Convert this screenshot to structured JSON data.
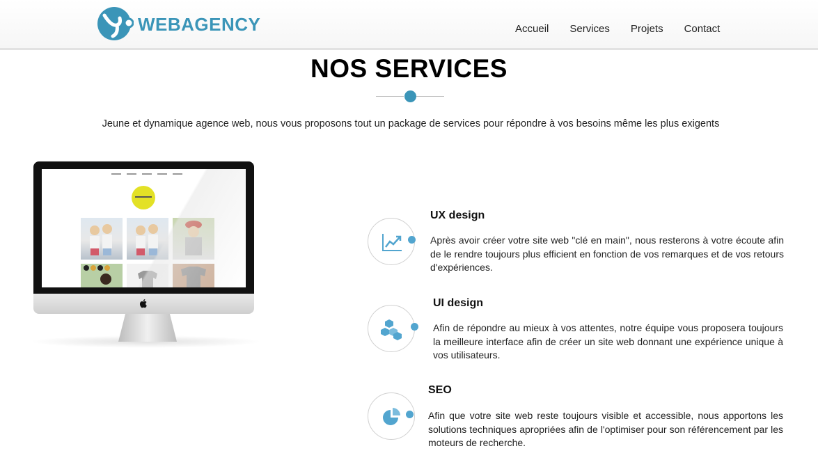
{
  "header": {
    "logo_text": "WEBAGENCY",
    "nav": [
      "Accueil",
      "Services",
      "Projets",
      "Contact"
    ]
  },
  "section": {
    "title": "NOS SERVICES",
    "intro": "Jeune et dynamique agence web, nous vous proposons tout un package de services pour répondre à vos besoins même les plus exigents"
  },
  "services": [
    {
      "title": "UX design",
      "text": "Après avoir créer votre site web \"clé en main\", nous resterons à votre écoute afin de le rendre toujours plus efficient en fonction de vos remarques et de vos retours d'expériences.",
      "icon": "chart-line-icon"
    },
    {
      "title": "UI design",
      "text": "Afin de répondre au mieux à vos attentes, notre équipe vous proposera toujours la meilleure interface afin de créer un site web donnant une expérience unique à vos utilisateurs.",
      "icon": "cubes-icon"
    },
    {
      "title": "SEO",
      "text": "Afin que votre site web reste toujours visible et accessible, nous apportons les solutions techniques apropriées afin de l'optimiser pour son référencement par les moteurs de recherche.",
      "icon": "pie-chart-icon"
    }
  ],
  "colors": {
    "accent": "#3b95b8",
    "icon": "#52a5cf",
    "mini_logo": "#e3e126"
  }
}
